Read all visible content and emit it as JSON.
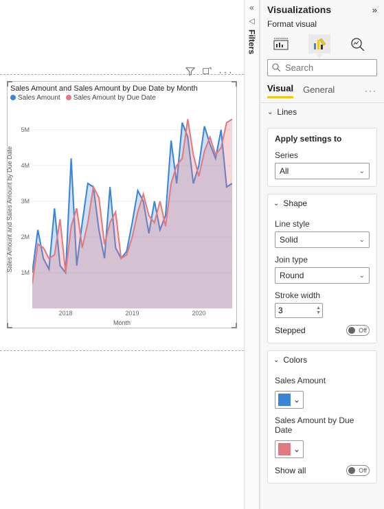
{
  "filters": {
    "label": "Filters"
  },
  "chart": {
    "title": "Sales Amount and Sales Amount by Due Date by Month",
    "legend": {
      "series1": "Sales Amount",
      "series2": "Sales Amount by Due Date"
    },
    "colors": {
      "series1": "#3a85d8",
      "series2": "#e17a80"
    },
    "y_label": "Sales Amount and Sales Amount by Due Date",
    "x_label": "Month",
    "y_ticks": [
      "1M",
      "2M",
      "3M",
      "4M",
      "5M"
    ],
    "x_ticks": [
      "2018",
      "2019",
      "2020"
    ]
  },
  "chart_data": {
    "type": "area",
    "xlabel": "Month",
    "ylabel": "Sales Amount and Sales Amount by Due Date",
    "ylim": [
      0,
      5500000
    ],
    "x": [
      "2017-07",
      "2017-08",
      "2017-09",
      "2017-10",
      "2017-11",
      "2017-12",
      "2018-01",
      "2018-02",
      "2018-03",
      "2018-04",
      "2018-05",
      "2018-06",
      "2018-07",
      "2018-08",
      "2018-09",
      "2018-10",
      "2018-11",
      "2018-12",
      "2019-01",
      "2019-02",
      "2019-03",
      "2019-04",
      "2019-05",
      "2019-06",
      "2019-07",
      "2019-08",
      "2019-09",
      "2019-10",
      "2019-11",
      "2019-12",
      "2020-01",
      "2020-02",
      "2020-03",
      "2020-04",
      "2020-05",
      "2020-06",
      "2020-07"
    ],
    "x_ticks": [
      "2018",
      "2019",
      "2020"
    ],
    "series": [
      {
        "name": "Sales Amount",
        "color": "#3a85d8",
        "values": [
          1000000,
          2200000,
          1400000,
          1100000,
          2800000,
          1200000,
          1000000,
          4200000,
          1200000,
          2400000,
          3500000,
          3400000,
          2200000,
          1400000,
          3400000,
          1700000,
          1400000,
          1600000,
          2400000,
          3300000,
          3000000,
          2100000,
          3000000,
          2200000,
          2600000,
          4700000,
          3500000,
          5200000,
          4800000,
          3500000,
          4000000,
          5100000,
          4600000,
          4200000,
          5000000,
          3400000,
          3500000
        ]
      },
      {
        "name": "Sales Amount by Due Date",
        "color": "#e17a80",
        "values": [
          700000,
          1800000,
          1700000,
          1400000,
          1500000,
          2500000,
          1000000,
          2300000,
          2800000,
          1700000,
          2400000,
          3400000,
          3100000,
          1800000,
          2400000,
          2700000,
          1400000,
          1500000,
          2000000,
          2700000,
          3200000,
          2600000,
          2400000,
          3000000,
          2300000,
          3500000,
          4000000,
          4200000,
          5300000,
          4300000,
          3700000,
          4400000,
          4800000,
          4300000,
          4500000,
          5200000,
          5300000
        ]
      }
    ]
  },
  "panel": {
    "title": "Visualizations",
    "subtitle": "Format visual",
    "search_placeholder": "Search",
    "tabs": {
      "visual": "Visual",
      "general": "General"
    },
    "sections": {
      "lines": {
        "label": "Lines",
        "apply": "Apply settings to",
        "series_label": "Series",
        "series_value": "All"
      },
      "shape": {
        "label": "Shape",
        "line_style_label": "Line style",
        "line_style_value": "Solid",
        "join_label": "Join type",
        "join_value": "Round",
        "stroke_label": "Stroke width",
        "stroke_value": "3",
        "stepped_label": "Stepped",
        "stepped_state": "Off"
      },
      "colors": {
        "label": "Colors",
        "s1_label": "Sales Amount",
        "s2_label": "Sales Amount by Due Date",
        "s1_hex": "#3a85d8",
        "s2_hex": "#e17a80",
        "show_all_label": "Show all",
        "show_all_state": "Off"
      }
    }
  }
}
